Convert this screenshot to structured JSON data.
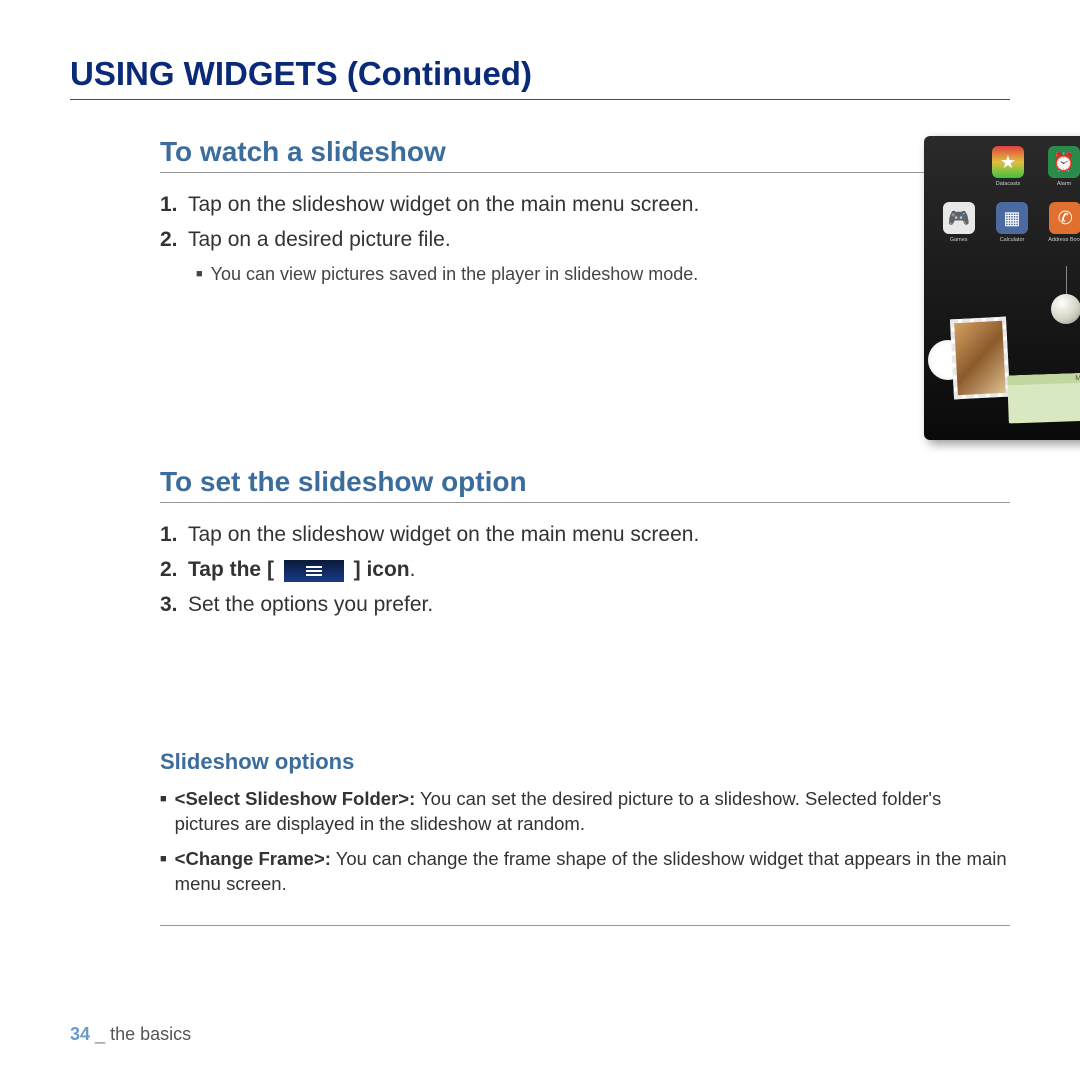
{
  "page_title": "USING WIDGETS (Continued)",
  "section1": {
    "title": "To watch a slideshow",
    "steps": [
      {
        "num": "1.",
        "text": "Tap on the slideshow widget on the main menu screen."
      },
      {
        "num": "2.",
        "text": "Tap on a desired picture file."
      }
    ],
    "sub": "You can view pictures saved in the player in slideshow mode."
  },
  "section2": {
    "title": "To set the slideshow option",
    "steps": {
      "s1": {
        "num": "1.",
        "text": "Tap on the slideshow widget on the main menu screen."
      },
      "s2": {
        "num": "2.",
        "pre": "Tap the [",
        "post": "] icon",
        "dot": "."
      },
      "s3": {
        "num": "3.",
        "text": "Set the options you prefer."
      }
    }
  },
  "options": {
    "title": "Slideshow options",
    "o1": {
      "label": "<Select Slideshow Folder>:",
      "text": " You can set the desired picture to a slideshow. Selected folder's pictures are displayed in the slideshow at random."
    },
    "o2": {
      "label": "<Change Frame>:",
      "text": "  You can change the frame shape of the slideshow widget that appears in the main menu screen."
    }
  },
  "device": {
    "icons": [
      {
        "glyph": "★",
        "bg": "transparent",
        "label": "Datacasts",
        "color": "linear"
      },
      {
        "glyph": "⏰",
        "bg": "#2a8a4a",
        "label": "Alarm"
      },
      {
        "glyph": "🎮",
        "bg": "#e8e8e8",
        "label": "Games"
      },
      {
        "glyph": "🖩",
        "bg": "#4a6aa0",
        "label": "Calculator"
      },
      {
        "glyph": "📕",
        "bg": "#e07030",
        "label": "Address Book"
      }
    ]
  },
  "footer": {
    "page": "34",
    "sep": "_",
    "chapter": "the basics"
  }
}
